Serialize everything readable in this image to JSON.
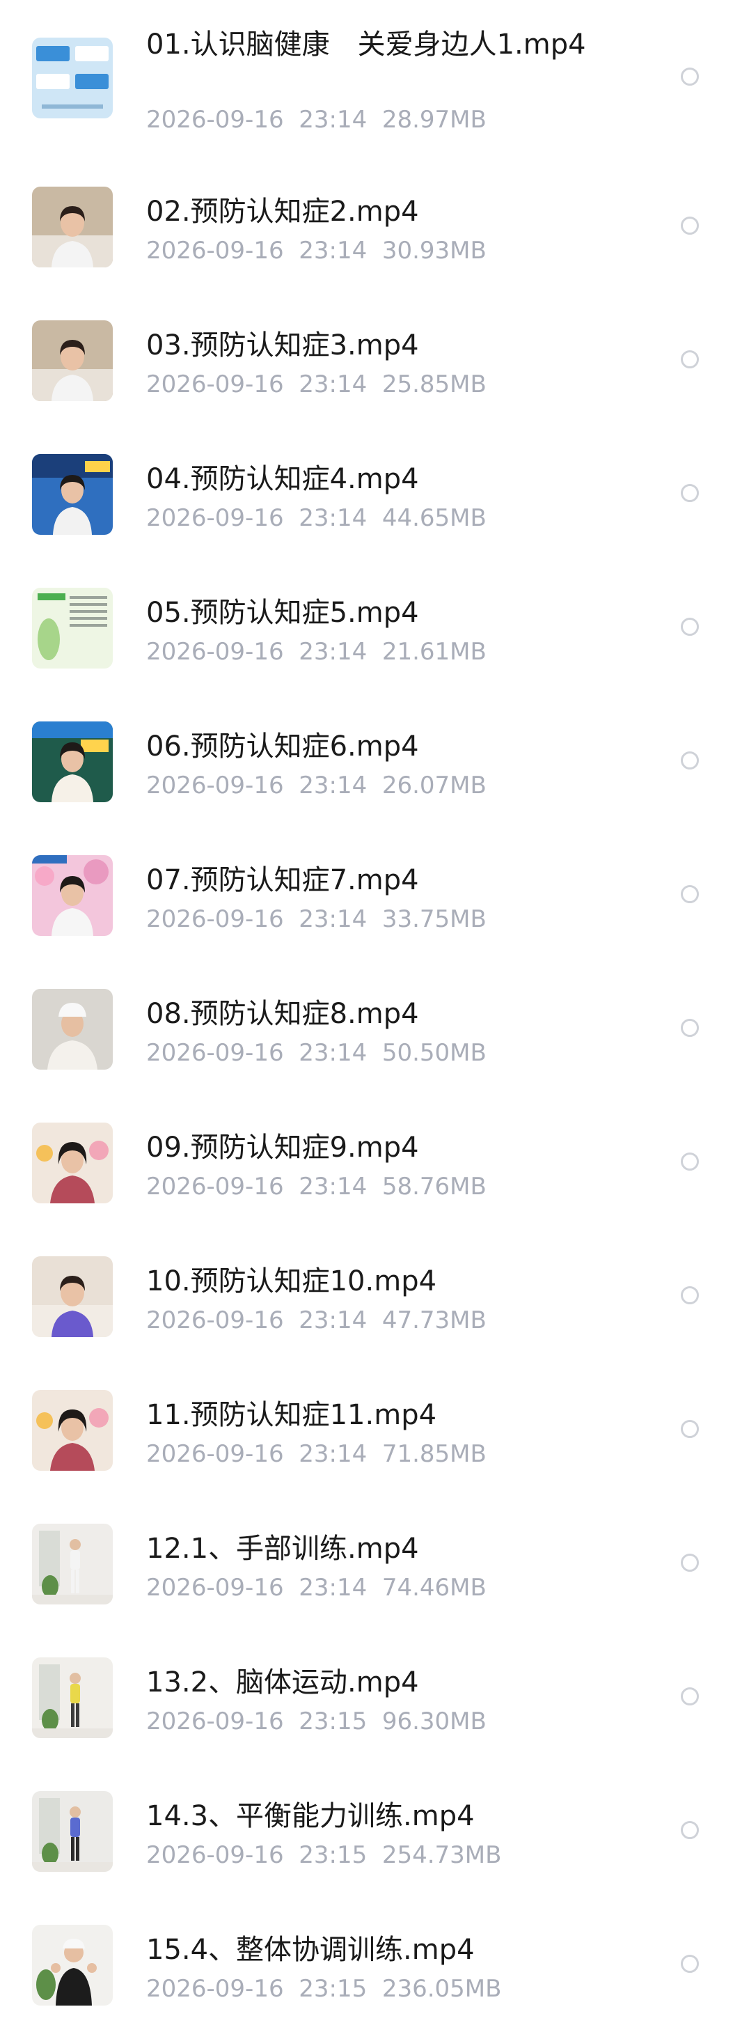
{
  "files": [
    {
      "name": "01.认识脑健康　关爱身边人1.mp4",
      "date": "2026-09-16",
      "time": "23:14",
      "size": "28.97MB",
      "thumb": "blue-infographic"
    },
    {
      "name": "02.预防认知症2.mp4",
      "date": "2026-09-16",
      "time": "23:14",
      "size": "30.93MB",
      "thumb": "presenter-office"
    },
    {
      "name": "03.预防认知症3.mp4",
      "date": "2026-09-16",
      "time": "23:14",
      "size": "25.85MB",
      "thumb": "presenter-office"
    },
    {
      "name": "04.预防认知症4.mp4",
      "date": "2026-09-16",
      "time": "23:14",
      "size": "44.65MB",
      "thumb": "presenter-blue-slide"
    },
    {
      "name": "05.预防认知症5.mp4",
      "date": "2026-09-16",
      "time": "23:14",
      "size": "21.61MB",
      "thumb": "green-document"
    },
    {
      "name": "06.预防认知症6.mp4",
      "date": "2026-09-16",
      "time": "23:14",
      "size": "26.07MB",
      "thumb": "presenter-board"
    },
    {
      "name": "07.预防认知症7.mp4",
      "date": "2026-09-16",
      "time": "23:14",
      "size": "33.75MB",
      "thumb": "presenter-flowers"
    },
    {
      "name": "08.预防认知症8.mp4",
      "date": "2026-09-16",
      "time": "23:14",
      "size": "50.50MB",
      "thumb": "presenter-white-hat"
    },
    {
      "name": "09.预防认知症9.mp4",
      "date": "2026-09-16",
      "time": "23:14",
      "size": "58.76MB",
      "thumb": "presenter-floral"
    },
    {
      "name": "10.预防认知症10.mp4",
      "date": "2026-09-16",
      "time": "23:14",
      "size": "47.73MB",
      "thumb": "presenter-purple"
    },
    {
      "name": "11.预防认知症11.mp4",
      "date": "2026-09-16",
      "time": "23:14",
      "size": "71.85MB",
      "thumb": "presenter-floral"
    },
    {
      "name": "12.1、手部训练.mp4",
      "date": "2026-09-16",
      "time": "23:14",
      "size": "74.46MB",
      "thumb": "exercise-room"
    },
    {
      "name": "13.2、脑体运动.mp4",
      "date": "2026-09-16",
      "time": "23:15",
      "size": "96.30MB",
      "thumb": "exercise-yellow"
    },
    {
      "name": "14.3、平衡能力训练.mp4",
      "date": "2026-09-16",
      "time": "23:15",
      "size": "254.73MB",
      "thumb": "exercise-balance"
    },
    {
      "name": "15.4、整体协调训练.mp4",
      "date": "2026-09-16",
      "time": "23:15",
      "size": "236.05MB",
      "thumb": "exercise-cap"
    }
  ],
  "colors": {
    "title": "#1a1a1a",
    "meta": "#a9adb8",
    "radio": "#cfd2d8"
  }
}
